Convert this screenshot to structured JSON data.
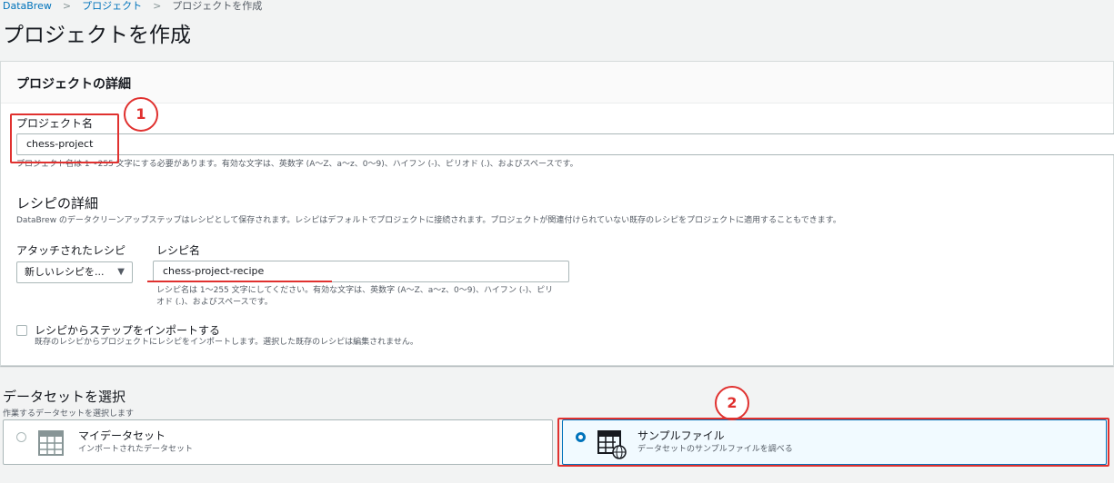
{
  "breadcrumb": {
    "items": [
      "DataBrew",
      "プロジェクト",
      "プロジェクトを作成"
    ],
    "separator": ">"
  },
  "page": {
    "title": "プロジェクトを作成"
  },
  "project_details": {
    "header": "プロジェクトの詳細",
    "name_label": "プロジェクト名",
    "name_value": "chess-project",
    "name_hint": "プロジェクト名は 1〜255 文字にする必要があります。有効な文字は、英数字 (A〜Z、a〜z、0〜9)、ハイフン (-)、ピリオド (.)、およびスペースです。"
  },
  "recipe_details": {
    "title": "レシピの詳細",
    "description": "DataBrew のデータクリーンアップステップはレシピとして保存されます。レシピはデフォルトでプロジェクトに接続されます。プロジェクトが関連付けられていない既存のレシピをプロジェクトに適用することもできます。",
    "attached_label": "アタッチされたレシピ",
    "attached_value": "新しいレシピを...",
    "recipe_name_label": "レシピ名",
    "recipe_name_value": "chess-project-recipe",
    "recipe_name_hint_line1": "レシピ名は 1〜255 文字にしてください。有効な文字は、英数字 (A〜Z、a〜z、0〜9)、ハイフン (-)、ピリ",
    "recipe_name_hint_line2": "オド (.)、およびスペースです。",
    "import_label": "レシピからステップをインポートする",
    "import_hint": "既存のレシピからプロジェクトにレシピをインポートします。選択した既存のレシピは編集されません。"
  },
  "dataset": {
    "title": "データセットを選択",
    "subtitle": "作業するデータセットを選択します",
    "options": [
      {
        "title": "マイデータセット",
        "desc": "インポートされたデータセット",
        "selected": false,
        "icon": "table-icon"
      },
      {
        "title": "サンプルファイル",
        "desc": "データセットのサンプルファイルを調べる",
        "selected": true,
        "icon": "table-globe-icon"
      }
    ]
  },
  "annotations": {
    "marker1": "1",
    "marker2": "2"
  },
  "colors": {
    "accent": "#0073bb",
    "annotation": "#e0312f",
    "background": "#f2f3f3"
  }
}
